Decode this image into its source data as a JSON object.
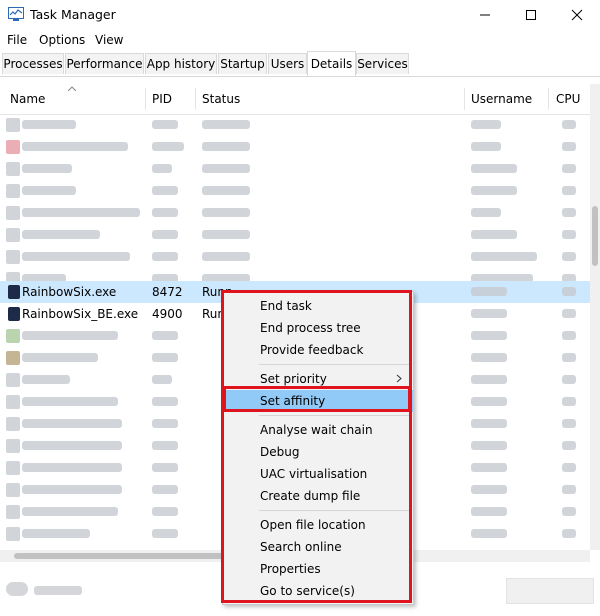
{
  "window": {
    "title": "Task Manager",
    "icon": "task-manager-icon"
  },
  "controls": {
    "minimize": "minimize-icon",
    "maximize": "maximize-icon",
    "close": "close-icon"
  },
  "menu": [
    "File",
    "Options",
    "View"
  ],
  "tabs": [
    "Processes",
    "Performance",
    "App history",
    "Startup",
    "Users",
    "Details",
    "Services"
  ],
  "active_tab": "Details",
  "columns": {
    "name": "Name",
    "pid": "PID",
    "status": "Status",
    "username": "Username",
    "cpu": "CPU"
  },
  "rows": {
    "rainbow": {
      "name": "RainbowSix.exe",
      "pid": "8472",
      "status": "Runn",
      "icon": "rainbow-six-icon",
      "icon_color": "#1e2b48"
    },
    "rainbow_be": {
      "name": "RainbowSix_BE.exe",
      "pid": "4900",
      "status": "Runn",
      "icon": "rainbow-six-be-icon",
      "icon_color": "#1e2b48"
    }
  },
  "context_menu": {
    "items": [
      "End task",
      "End process tree",
      "Provide feedback",
      "Set priority",
      "Set affinity",
      "Analyse wait chain",
      "Debug",
      "UAC virtualisation",
      "Create dump file",
      "Open file location",
      "Search online",
      "Properties",
      "Go to service(s)"
    ],
    "highlighted": "Set affinity",
    "submenu_item": "Set priority"
  },
  "colors": {
    "selection": "#cce8ff",
    "menu_highlight": "#91c9f7",
    "annotation_red": "#e0141e"
  }
}
